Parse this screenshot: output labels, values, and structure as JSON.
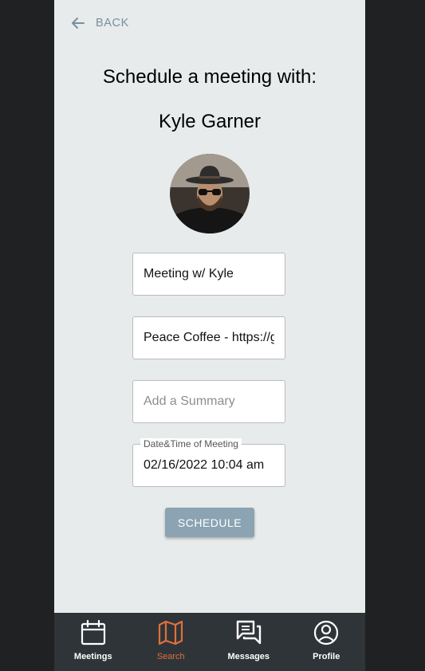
{
  "header": {
    "back_label": "BACK"
  },
  "main": {
    "title": "Schedule a meeting with:",
    "contact_name": "Kyle Garner"
  },
  "form": {
    "meeting_title": {
      "value": "Meeting w/ Kyle"
    },
    "location": {
      "value": "Peace Coffee - https://g"
    },
    "summary": {
      "placeholder": "Add a Summary",
      "value": ""
    },
    "datetime": {
      "label": "Date&Time of Meeting",
      "value": "02/16/2022 10:04 am"
    },
    "submit_label": "SCHEDULE"
  },
  "nav": {
    "items": [
      {
        "label": "Meetings",
        "icon": "calendar-icon",
        "active": false
      },
      {
        "label": "Search",
        "icon": "map-icon",
        "active": true
      },
      {
        "label": "Messages",
        "icon": "chat-icon",
        "active": false
      },
      {
        "label": "Profile",
        "icon": "user-circle-icon",
        "active": false
      }
    ]
  },
  "colors": {
    "background": "#e8ebeb",
    "accent": "#e0703d",
    "button": "#8ba3b2",
    "nav_background": "#2f3438",
    "back_link": "#7a8ea0"
  }
}
